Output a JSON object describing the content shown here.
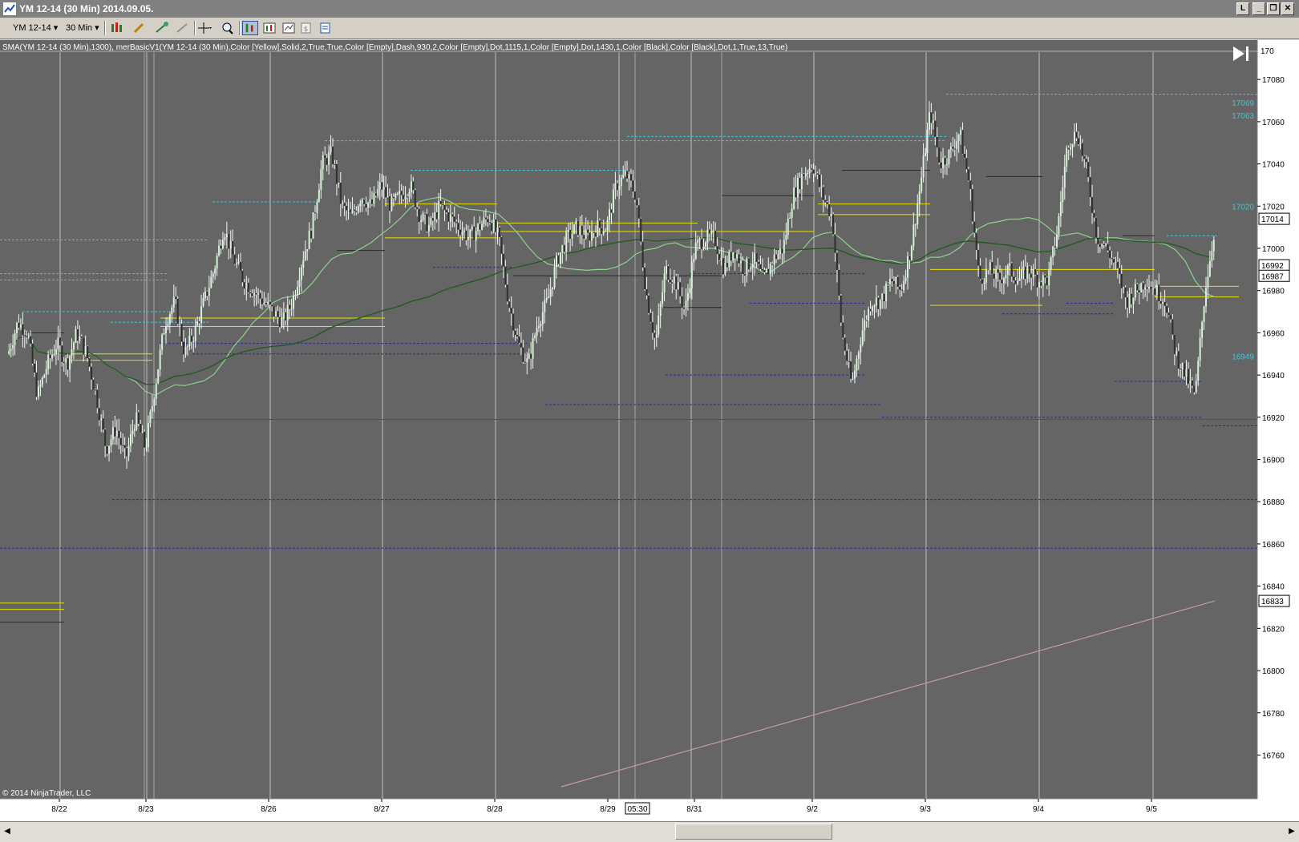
{
  "window": {
    "title": "YM 12-14 (30 Min)  2014.09.05.",
    "buttons": [
      "L",
      "_",
      "❐",
      "✕"
    ]
  },
  "toolbar": {
    "instrument": "YM 12-14",
    "interval": "30 Min"
  },
  "indicator_label": "SMA(YM 12-14 (30 Min),1300), merBasicV1(YM 12-14 (30 Min),Color [Yellow],Solid,2,True,True,Color [Empty],Dash,930,2,Color [Empty],Dot,1115,1,Color [Empty],Dot,1430,1,Color [Black],Color [Black],Dot,1,True,13,True)",
  "copyright": "© 2014 NinjaTrader, LLC",
  "price_axis": {
    "ticks": [
      "17080",
      "17060",
      "17040",
      "17020",
      "17000",
      "16980",
      "16960",
      "16940",
      "16920",
      "16900",
      "16880",
      "16860",
      "16840",
      "16820",
      "16800",
      "16780",
      "16760"
    ],
    "top_partial_label": "170",
    "boxed_labels": [
      "17014",
      "16992",
      "16987",
      "16833"
    ],
    "cyan_labels": [
      "17069",
      "17063",
      "17020",
      "16949"
    ]
  },
  "time_axis": {
    "labels": [
      "8/22",
      "8/23",
      "8/26",
      "8/27",
      "8/28",
      "8/29",
      "8/31",
      "9/2",
      "9/3",
      "9/4",
      "9/5"
    ],
    "cursor_time": "05:30"
  },
  "colors": {
    "chart_bg": "#656565",
    "grid_line": "#d0d0d0",
    "sma_fast": "#90d090",
    "sma_slow": "#1f5a1f",
    "sma_1300": "#c89aa0",
    "resistance": "#38c8d8",
    "support": "#2a2aa0",
    "pivot": "#e8e000",
    "level_red": "#c0203a"
  },
  "chart_data": {
    "type": "candlestick",
    "instrument": "YM 12-14",
    "interval": "30 Min",
    "ylim": [
      16745,
      17085
    ],
    "session_dates": [
      "8/22",
      "8/23",
      "8/26",
      "8/27",
      "8/28",
      "8/29",
      "8/31",
      "9/2",
      "9/3",
      "9/4",
      "9/5"
    ],
    "close_trace": [
      [
        0,
        16950
      ],
      [
        2,
        16965
      ],
      [
        4,
        16960
      ],
      [
        6,
        16930
      ],
      [
        8,
        16945
      ],
      [
        10,
        16955
      ],
      [
        12,
        16945
      ],
      [
        14,
        16960
      ],
      [
        16,
        16950
      ],
      [
        18,
        16930
      ],
      [
        20,
        16905
      ],
      [
        22,
        16915
      ],
      [
        24,
        16900
      ],
      [
        26,
        16920
      ],
      [
        28,
        16905
      ],
      [
        30,
        16935
      ],
      [
        32,
        16965
      ],
      [
        34,
        16975
      ],
      [
        36,
        16950
      ],
      [
        38,
        16960
      ],
      [
        40,
        16975
      ],
      [
        42,
        16990
      ],
      [
        44,
        17010
      ],
      [
        46,
        16995
      ],
      [
        48,
        16985
      ],
      [
        50,
        16980
      ],
      [
        52,
        16975
      ],
      [
        54,
        16970
      ],
      [
        56,
        16965
      ],
      [
        58,
        16975
      ],
      [
        60,
        16995
      ],
      [
        62,
        17010
      ],
      [
        64,
        17040
      ],
      [
        66,
        17045
      ],
      [
        68,
        17020
      ],
      [
        70,
        17015
      ],
      [
        72,
        17025
      ],
      [
        74,
        17020
      ],
      [
        76,
        17030
      ],
      [
        78,
        17020
      ],
      [
        80,
        17025
      ],
      [
        82,
        17030
      ],
      [
        84,
        17015
      ],
      [
        86,
        17010
      ],
      [
        88,
        17020
      ],
      [
        90,
        17015
      ],
      [
        92,
        17010
      ],
      [
        94,
        17005
      ],
      [
        96,
        17010
      ],
      [
        98,
        17015
      ],
      [
        100,
        17005
      ],
      [
        102,
        16975
      ],
      [
        104,
        16955
      ],
      [
        106,
        16945
      ],
      [
        108,
        16965
      ],
      [
        110,
        16975
      ],
      [
        112,
        16995
      ],
      [
        114,
        17005
      ],
      [
        116,
        17010
      ],
      [
        118,
        17005
      ],
      [
        120,
        17010
      ],
      [
        122,
        17010
      ],
      [
        124,
        17030
      ],
      [
        126,
        17035
      ],
      [
        128,
        17025
      ],
      [
        130,
        16980
      ],
      [
        132,
        16955
      ],
      [
        134,
        16990
      ],
      [
        136,
        16985
      ],
      [
        138,
        16970
      ],
      [
        140,
        17000
      ],
      [
        142,
        17005
      ],
      [
        144,
        17005
      ],
      [
        146,
        16990
      ],
      [
        148,
        17000
      ],
      [
        150,
        16990
      ],
      [
        152,
        16995
      ],
      [
        154,
        16985
      ],
      [
        156,
        16995
      ],
      [
        158,
        17000
      ],
      [
        160,
        17025
      ],
      [
        162,
        17035
      ],
      [
        164,
        17040
      ],
      [
        166,
        17025
      ],
      [
        168,
        17015
      ],
      [
        170,
        16960
      ],
      [
        172,
        16935
      ],
      [
        174,
        16960
      ],
      [
        176,
        16975
      ],
      [
        178,
        16975
      ],
      [
        180,
        16985
      ],
      [
        182,
        16980
      ],
      [
        184,
        17000
      ],
      [
        186,
        17030
      ],
      [
        188,
        17065
      ],
      [
        190,
        17040
      ],
      [
        192,
        17045
      ],
      [
        194,
        17055
      ],
      [
        196,
        17030
      ],
      [
        198,
        16985
      ],
      [
        200,
        16990
      ],
      [
        202,
        16985
      ],
      [
        204,
        16990
      ],
      [
        206,
        16985
      ],
      [
        208,
        16990
      ],
      [
        210,
        16985
      ],
      [
        212,
        16985
      ],
      [
        214,
        17010
      ],
      [
        216,
        17050
      ],
      [
        218,
        17055
      ],
      [
        220,
        17035
      ],
      [
        222,
        17005
      ],
      [
        224,
        17000
      ],
      [
        226,
        16990
      ],
      [
        228,
        16975
      ],
      [
        230,
        16980
      ],
      [
        232,
        16985
      ],
      [
        234,
        16980
      ],
      [
        236,
        16975
      ],
      [
        238,
        16950
      ],
      [
        240,
        16940
      ],
      [
        242,
        16930
      ],
      [
        244,
        16980
      ],
      [
        246,
        17010
      ]
    ]
  }
}
